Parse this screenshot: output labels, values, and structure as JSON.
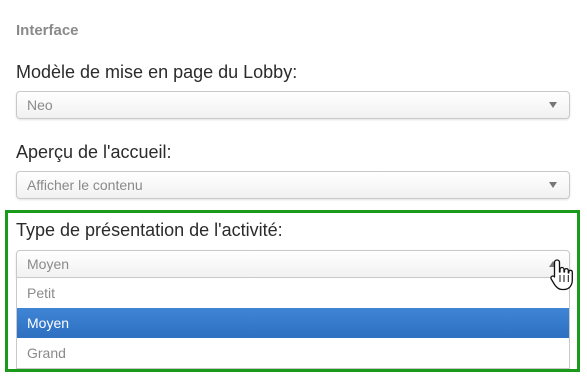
{
  "section": {
    "title": "Interface"
  },
  "lobby_layout": {
    "label": "Modèle de mise en page du Lobby:",
    "value": "Neo"
  },
  "home_preview": {
    "label": "Aperçu de l'accueil:",
    "value": "Afficher le contenu"
  },
  "activity_presentation": {
    "label": "Type de présentation de l'activité:",
    "value": "Moyen",
    "options": [
      "Petit",
      "Moyen",
      "Grand"
    ],
    "selected_option": "Moyen"
  },
  "colors": {
    "highlight_border": "#1a9a1a",
    "selected_option_bg": "#3478cb"
  },
  "icons": {
    "cursor": "hand-pointer-icon",
    "caret_closed": "caret-down-icon",
    "caret_open": "caret-up-icon"
  }
}
